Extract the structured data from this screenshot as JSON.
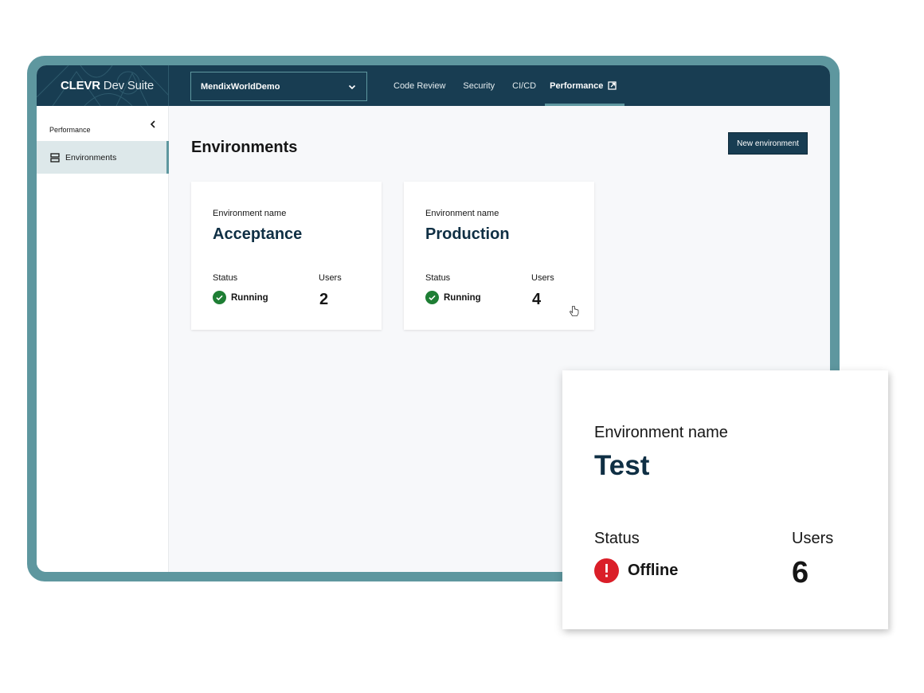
{
  "header": {
    "brand_bold": "CLEVR",
    "brand_rest": " Dev Suite",
    "app_selector": {
      "value": "MendixWorldDemo"
    },
    "nav": [
      {
        "label": "Code Review",
        "active": false
      },
      {
        "label": "Security",
        "active": false
      },
      {
        "label": "CI/CD",
        "active": false
      },
      {
        "label": "Performance",
        "active": true,
        "external": true
      }
    ]
  },
  "sidebar": {
    "title": "Performance",
    "items": [
      {
        "label": "Environments",
        "icon": "server-icon",
        "active": true
      }
    ]
  },
  "main": {
    "title": "Environments",
    "new_button": "New environment",
    "field_labels": {
      "env_name": "Environment name",
      "status": "Status",
      "users": "Users"
    },
    "environments": [
      {
        "name": "Acceptance",
        "status": "Running",
        "users": "2"
      },
      {
        "name": "Production",
        "status": "Running",
        "users": "4"
      },
      {
        "name": "Test",
        "status": "Offline",
        "users": "6"
      }
    ]
  },
  "colors": {
    "frame": "#5e979f",
    "header_bg": "#183d52",
    "accent": "#5e979f",
    "running": "#1e7e34",
    "offline": "#da1e28",
    "env_name": "#0f2f44"
  }
}
